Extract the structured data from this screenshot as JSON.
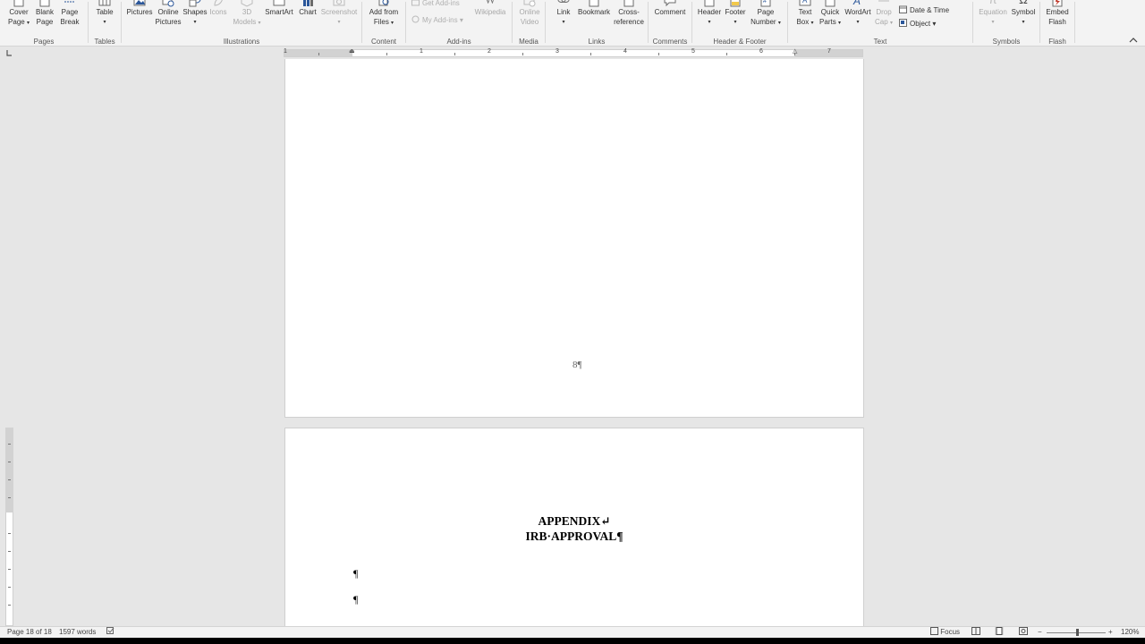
{
  "ribbon": {
    "groups": {
      "pages": "Pages",
      "tables": "Tables",
      "illustrations": "Illustrations",
      "content": "Content",
      "addins": "Add-ins",
      "media": "Media",
      "links": "Links",
      "comments": "Comments",
      "header_footer": "Header & Footer",
      "text": "Text",
      "symbols": "Symbols",
      "flash": "Flash"
    },
    "buttons": {
      "cover_page": [
        "Cover",
        "Page"
      ],
      "blank_page": [
        "Blank",
        "Page"
      ],
      "page_break": [
        "Page",
        "Break"
      ],
      "table": [
        "Table",
        ""
      ],
      "pictures": [
        "Pictures",
        ""
      ],
      "online_pictures": [
        "Online",
        "Pictures"
      ],
      "shapes": [
        "Shapes",
        ""
      ],
      "icons": [
        "Icons",
        ""
      ],
      "models_3d": [
        "3D",
        "Models"
      ],
      "smartart": [
        "SmartArt",
        ""
      ],
      "chart": [
        "Chart",
        ""
      ],
      "screenshot": [
        "Screenshot",
        ""
      ],
      "add_from_files": [
        "Add from",
        "Files"
      ],
      "get_addins": "Get Add-ins",
      "my_addins": "My Add-ins",
      "wikipedia": "Wikipedia",
      "online_video": [
        "Online",
        "Video"
      ],
      "link": [
        "Link",
        ""
      ],
      "bookmark": [
        "Bookmark",
        ""
      ],
      "cross_reference": [
        "Cross-",
        "reference"
      ],
      "comment": [
        "Comment",
        ""
      ],
      "header": [
        "Header",
        ""
      ],
      "footer": [
        "Footer",
        ""
      ],
      "page_number": [
        "Page",
        "Number"
      ],
      "text_box": [
        "Text",
        "Box"
      ],
      "quick_parts": [
        "Quick",
        "Parts"
      ],
      "wordart": [
        "WordArt",
        ""
      ],
      "drop_cap": [
        "Drop",
        "Cap"
      ],
      "date_time": "Date & Time",
      "object": "Object",
      "equation": [
        "Equation",
        ""
      ],
      "symbol": [
        "Symbol",
        ""
      ],
      "embed_flash": [
        "Embed",
        "Flash"
      ]
    }
  },
  "ruler": {
    "numbers": [
      "1",
      "1",
      "2",
      "3",
      "4",
      "5",
      "6",
      "7"
    ]
  },
  "document": {
    "page1": {
      "page_number": "8¶"
    },
    "page2": {
      "line1": "APPENDIX↵",
      "line2": "IRB·APPROVAL¶",
      "para1": "¶",
      "para2": "¶"
    }
  },
  "status": {
    "page": "Page 18 of 18",
    "words": "1597 words",
    "focus": "Focus",
    "zoom": "120%",
    "zoom_minus": "−",
    "zoom_plus": "+"
  },
  "colors": {
    "ribbon_bg": "#f3f3f3",
    "canvas_bg": "#e6e6e6",
    "accent_blue": "#2b579a",
    "icon_gray": "#6b6b6b"
  }
}
